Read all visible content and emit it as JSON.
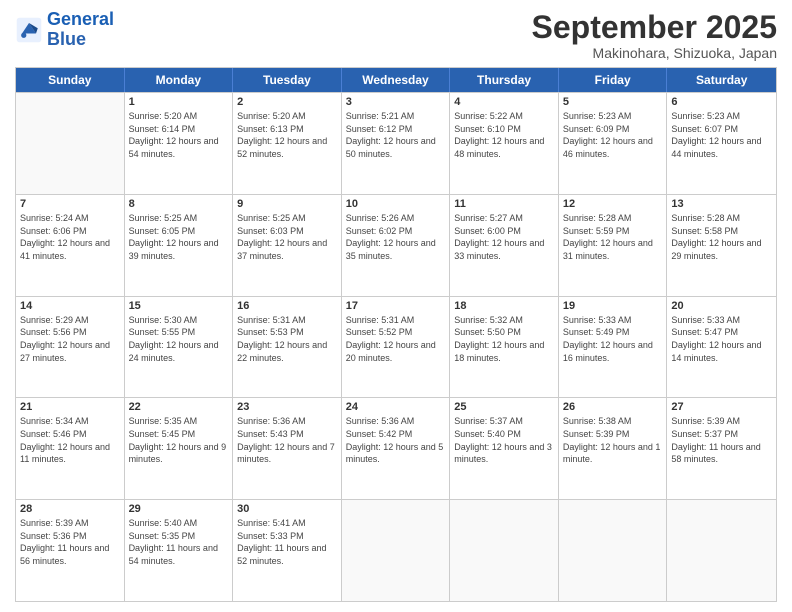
{
  "logo": {
    "line1": "General",
    "line2": "Blue"
  },
  "title": "September 2025",
  "location": "Makinohara, Shizuoka, Japan",
  "days": [
    "Sunday",
    "Monday",
    "Tuesday",
    "Wednesday",
    "Thursday",
    "Friday",
    "Saturday"
  ],
  "weeks": [
    [
      {
        "date": "",
        "empty": true
      },
      {
        "date": "1",
        "sunrise": "5:20 AM",
        "sunset": "6:14 PM",
        "daylight": "12 hours and 54 minutes."
      },
      {
        "date": "2",
        "sunrise": "5:20 AM",
        "sunset": "6:13 PM",
        "daylight": "12 hours and 52 minutes."
      },
      {
        "date": "3",
        "sunrise": "5:21 AM",
        "sunset": "6:12 PM",
        "daylight": "12 hours and 50 minutes."
      },
      {
        "date": "4",
        "sunrise": "5:22 AM",
        "sunset": "6:10 PM",
        "daylight": "12 hours and 48 minutes."
      },
      {
        "date": "5",
        "sunrise": "5:23 AM",
        "sunset": "6:09 PM",
        "daylight": "12 hours and 46 minutes."
      },
      {
        "date": "6",
        "sunrise": "5:23 AM",
        "sunset": "6:07 PM",
        "daylight": "12 hours and 44 minutes."
      }
    ],
    [
      {
        "date": "7",
        "sunrise": "5:24 AM",
        "sunset": "6:06 PM",
        "daylight": "12 hours and 41 minutes."
      },
      {
        "date": "8",
        "sunrise": "5:25 AM",
        "sunset": "6:05 PM",
        "daylight": "12 hours and 39 minutes."
      },
      {
        "date": "9",
        "sunrise": "5:25 AM",
        "sunset": "6:03 PM",
        "daylight": "12 hours and 37 minutes."
      },
      {
        "date": "10",
        "sunrise": "5:26 AM",
        "sunset": "6:02 PM",
        "daylight": "12 hours and 35 minutes."
      },
      {
        "date": "11",
        "sunrise": "5:27 AM",
        "sunset": "6:00 PM",
        "daylight": "12 hours and 33 minutes."
      },
      {
        "date": "12",
        "sunrise": "5:28 AM",
        "sunset": "5:59 PM",
        "daylight": "12 hours and 31 minutes."
      },
      {
        "date": "13",
        "sunrise": "5:28 AM",
        "sunset": "5:58 PM",
        "daylight": "12 hours and 29 minutes."
      }
    ],
    [
      {
        "date": "14",
        "sunrise": "5:29 AM",
        "sunset": "5:56 PM",
        "daylight": "12 hours and 27 minutes."
      },
      {
        "date": "15",
        "sunrise": "5:30 AM",
        "sunset": "5:55 PM",
        "daylight": "12 hours and 24 minutes."
      },
      {
        "date": "16",
        "sunrise": "5:31 AM",
        "sunset": "5:53 PM",
        "daylight": "12 hours and 22 minutes."
      },
      {
        "date": "17",
        "sunrise": "5:31 AM",
        "sunset": "5:52 PM",
        "daylight": "12 hours and 20 minutes."
      },
      {
        "date": "18",
        "sunrise": "5:32 AM",
        "sunset": "5:50 PM",
        "daylight": "12 hours and 18 minutes."
      },
      {
        "date": "19",
        "sunrise": "5:33 AM",
        "sunset": "5:49 PM",
        "daylight": "12 hours and 16 minutes."
      },
      {
        "date": "20",
        "sunrise": "5:33 AM",
        "sunset": "5:47 PM",
        "daylight": "12 hours and 14 minutes."
      }
    ],
    [
      {
        "date": "21",
        "sunrise": "5:34 AM",
        "sunset": "5:46 PM",
        "daylight": "12 hours and 11 minutes."
      },
      {
        "date": "22",
        "sunrise": "5:35 AM",
        "sunset": "5:45 PM",
        "daylight": "12 hours and 9 minutes."
      },
      {
        "date": "23",
        "sunrise": "5:36 AM",
        "sunset": "5:43 PM",
        "daylight": "12 hours and 7 minutes."
      },
      {
        "date": "24",
        "sunrise": "5:36 AM",
        "sunset": "5:42 PM",
        "daylight": "12 hours and 5 minutes."
      },
      {
        "date": "25",
        "sunrise": "5:37 AM",
        "sunset": "5:40 PM",
        "daylight": "12 hours and 3 minutes."
      },
      {
        "date": "26",
        "sunrise": "5:38 AM",
        "sunset": "5:39 PM",
        "daylight": "12 hours and 1 minute."
      },
      {
        "date": "27",
        "sunrise": "5:39 AM",
        "sunset": "5:37 PM",
        "daylight": "11 hours and 58 minutes."
      }
    ],
    [
      {
        "date": "28",
        "sunrise": "5:39 AM",
        "sunset": "5:36 PM",
        "daylight": "11 hours and 56 minutes."
      },
      {
        "date": "29",
        "sunrise": "5:40 AM",
        "sunset": "5:35 PM",
        "daylight": "11 hours and 54 minutes."
      },
      {
        "date": "30",
        "sunrise": "5:41 AM",
        "sunset": "5:33 PM",
        "daylight": "11 hours and 52 minutes."
      },
      {
        "date": "",
        "empty": true
      },
      {
        "date": "",
        "empty": true
      },
      {
        "date": "",
        "empty": true
      },
      {
        "date": "",
        "empty": true
      }
    ]
  ]
}
